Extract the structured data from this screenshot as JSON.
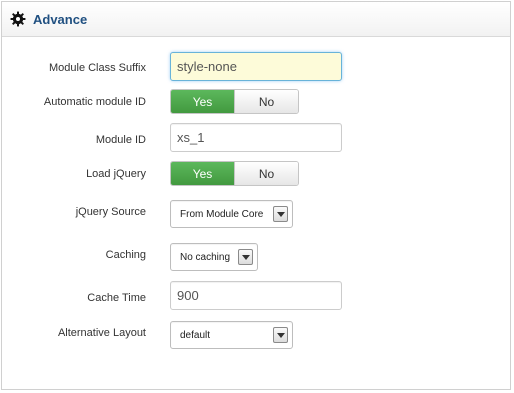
{
  "panel": {
    "title": "Advance",
    "icon": "gear-icon"
  },
  "fields": {
    "module_class_suffix": {
      "label": "Module Class Suffix",
      "value": "style-none"
    },
    "automatic_module_id": {
      "label": "Automatic module ID",
      "yes": "Yes",
      "no": "No",
      "selected": "Yes"
    },
    "module_id": {
      "label": "Module ID",
      "value": "xs_1"
    },
    "load_jquery": {
      "label": "Load jQuery",
      "yes": "Yes",
      "no": "No",
      "selected": "Yes"
    },
    "jquery_source": {
      "label": "jQuery Source",
      "value": "From Module Core"
    },
    "caching": {
      "label": "Caching",
      "value": "No caching"
    },
    "cache_time": {
      "label": "Cache Time",
      "value": "900"
    },
    "alternative_layout": {
      "label": "Alternative Layout",
      "value": "default"
    }
  },
  "colors": {
    "accent_title": "#205081",
    "toggle_active": "#4cae4c",
    "focus_background": "#fdfbd9"
  }
}
